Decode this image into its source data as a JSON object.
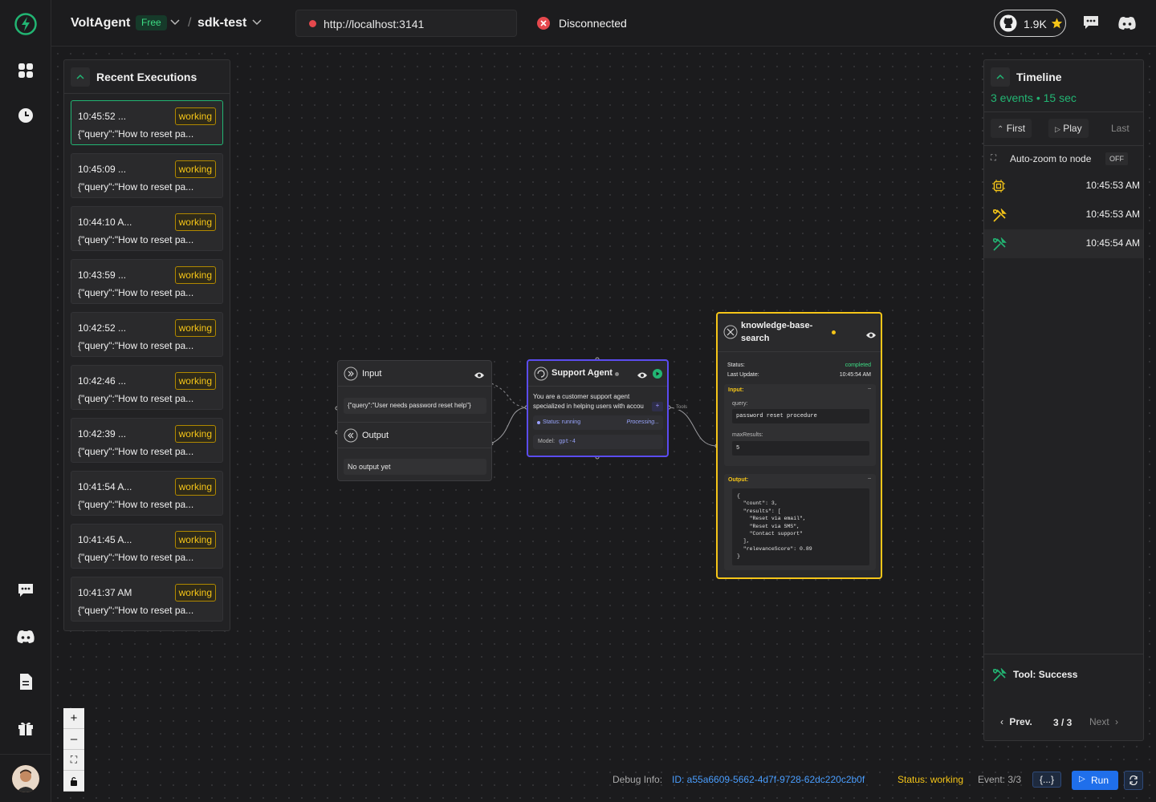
{
  "header": {
    "brand": "VoltAgent",
    "plan_badge": "Free",
    "separator": "/",
    "project": "sdk-test",
    "url": "http://localhost:3141",
    "connection_status": "Disconnected",
    "github_stars": "1.9K"
  },
  "recent": {
    "title": "Recent Executions",
    "items": [
      {
        "time": "10:45:52 ...",
        "status": "working",
        "query": "{\"query\":\"How to reset pa..."
      },
      {
        "time": "10:45:09 ...",
        "status": "working",
        "query": "{\"query\":\"How to reset pa..."
      },
      {
        "time": "10:44:10 A...",
        "status": "working",
        "query": "{\"query\":\"How to reset pa..."
      },
      {
        "time": "10:43:59 ...",
        "status": "working",
        "query": "{\"query\":\"How to reset pa..."
      },
      {
        "time": "10:42:52 ...",
        "status": "working",
        "query": "{\"query\":\"How to reset pa..."
      },
      {
        "time": "10:42:46 ...",
        "status": "working",
        "query": "{\"query\":\"How to reset pa..."
      },
      {
        "time": "10:42:39 ...",
        "status": "working",
        "query": "{\"query\":\"How to reset pa..."
      },
      {
        "time": "10:41:54 A...",
        "status": "working",
        "query": "{\"query\":\"How to reset pa..."
      },
      {
        "time": "10:41:45 A...",
        "status": "working",
        "query": "{\"query\":\"How to reset pa..."
      },
      {
        "time": "10:41:37 AM",
        "status": "working",
        "query": "{\"query\":\"How to reset pa..."
      }
    ]
  },
  "timeline": {
    "title": "Timeline",
    "summary": "3 events • 15 sec",
    "first": "First",
    "play": "Play",
    "last": "Last",
    "autozoom": "Auto-zoom to node",
    "autozoom_state": "OFF",
    "events": [
      {
        "icon": "cpu-icon",
        "time": "10:45:53 AM",
        "color": "#f5c518"
      },
      {
        "icon": "tool-icon",
        "time": "10:45:53 AM",
        "color": "#f5c518"
      },
      {
        "icon": "tool-icon",
        "time": "10:45:54 AM",
        "color": "#22b573"
      }
    ],
    "selected_label": "Tool: Success",
    "prev": "Prev.",
    "position": "3 / 3",
    "next": "Next"
  },
  "input_node": {
    "title": "Input",
    "value": "{\"query\":\"User needs password reset help\"}",
    "output_title": "Output",
    "output_value": "No output yet"
  },
  "agent_node": {
    "title": "Support Agent",
    "description_line1": "You are a customer support agent",
    "description_line2": "specialized in helping users with accou",
    "status": "Status: running",
    "processing": "Processing...",
    "model_label": "Model:",
    "model": "gpt-4",
    "tools_label": "Tools"
  },
  "tool_node": {
    "title_line1": "knowledge-base-",
    "title_line2": "search",
    "status_label": "Status:",
    "status": "completed",
    "last_update_label": "Last Update:",
    "last_update": "10:45:54 AM",
    "input_label": "Input:",
    "query_label": "query:",
    "query": "password reset procedure",
    "max_label": "maxResults:",
    "max": "5",
    "output_label": "Output:",
    "output_lines": [
      "{",
      "  \"count\": 3,",
      "  \"results\": [",
      "    \"Reset via email\",",
      "    \"Reset via SMS\",",
      "    \"Contact support\"",
      "  ],",
      "  \"relevanceScore\": 0.89",
      "}"
    ]
  },
  "debug": {
    "label": "Debug Info:",
    "id": "ID: a55a6609-5662-4d7f-9728-62dc220c2b0f",
    "status": "Status: working",
    "event": "Event: 3/3",
    "json_btn": "{...}",
    "run": "Run"
  },
  "colors": {
    "accent_green": "#22b573",
    "warning_yellow": "#f5c518",
    "agent_purple": "#5b4cf0",
    "run_blue": "#1f6feb"
  }
}
